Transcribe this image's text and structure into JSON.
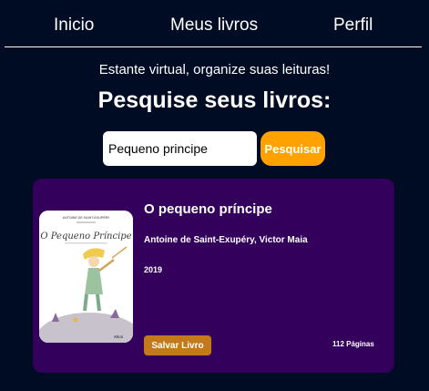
{
  "nav": {
    "items": [
      {
        "label": "Inicio"
      },
      {
        "label": "Meus livros"
      },
      {
        "label": "Perfil"
      }
    ]
  },
  "hero": {
    "subtitle": "Estante virtual, organize suas leituras!",
    "heading": "Pesquise seus livros:"
  },
  "search": {
    "value": "Pequeno principe",
    "button_label": "Pesquisar"
  },
  "book": {
    "title": "O pequeno príncipe",
    "authors": "Antoine de Saint-Exupéry, Victor Maia",
    "year": "2019",
    "save_label": "Salvar Livro",
    "pages": "112 Páginas",
    "cover": {
      "author_line": "ANTOINE DE SAINT-EXUPÉRY",
      "title": "O Pequeno Príncipe",
      "publisher": "Mirai"
    }
  },
  "colors": {
    "background": "#000b24",
    "card": "#33005c",
    "accent": "#ffa200",
    "save_button": "#c47a1b"
  }
}
